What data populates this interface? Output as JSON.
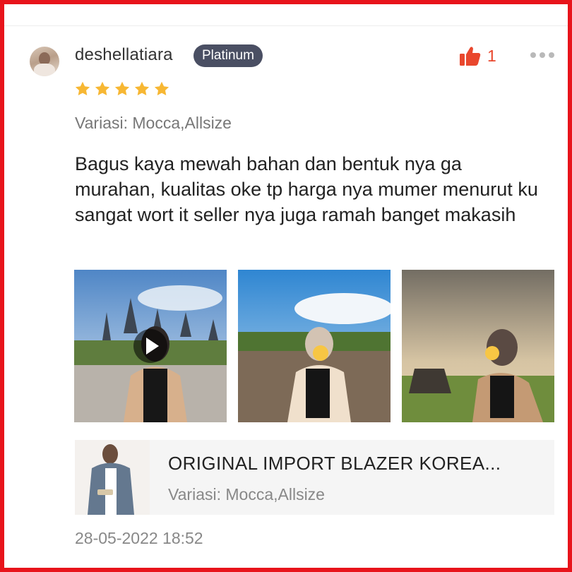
{
  "review": {
    "username": "deshellatiara",
    "badge": "Platinum",
    "like_count": "1",
    "rating": 5,
    "variation": "Variasi: Mocca,Allsize",
    "text": "Bagus kaya mewah bahan dan bentuk nya ga murahan, kualitas oke tp harga nya mumer menurut ku sangat wort it seller nya juga ramah banget makasih",
    "timestamp": "28-05-2022 18:52"
  },
  "product": {
    "title": "ORIGINAL IMPORT BLAZER KOREA...",
    "variation": "Variasi: Mocca,Allsize"
  },
  "icons": {
    "like": "thumbs-up-icon",
    "more": "more-dots-icon",
    "star": "star-icon",
    "play": "play-icon"
  },
  "colors": {
    "accent": "#e9472d",
    "star": "#f7b733",
    "badge": "#4a4f63",
    "frame": "#e8141b"
  }
}
